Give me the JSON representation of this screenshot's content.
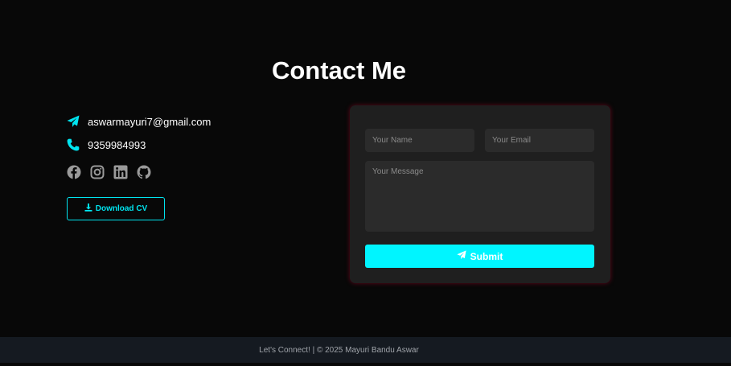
{
  "page": {
    "title": "Contact Me"
  },
  "contact": {
    "email": "aswarmayuri7@gmail.com",
    "phone": "9359984993",
    "accent_color": "#00e5f0",
    "socials": [
      "facebook-icon",
      "instagram-icon",
      "linkedin-icon",
      "github-icon"
    ]
  },
  "cv_button": {
    "label": "Download CV",
    "icon": "download-icon"
  },
  "form": {
    "name_placeholder": "Your Name",
    "email_placeholder": "Your Email",
    "message_placeholder": "Your Message",
    "submit_label": "Submit",
    "submit_color": "#00f5ff"
  },
  "footer": {
    "text": "Let's Connect! | © 2025 Mayuri Bandu Aswar"
  }
}
